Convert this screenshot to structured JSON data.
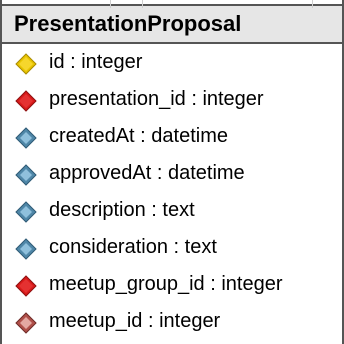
{
  "entity": {
    "title": "PresentationProposal",
    "attributes": [
      {
        "label": "id : integer",
        "icon": "primary-key-icon",
        "color": "#e8c400"
      },
      {
        "label": "presentation_id : integer",
        "icon": "foreign-key-icon",
        "color": "#d81a1a"
      },
      {
        "label": "createdAt : datetime",
        "icon": "column-icon",
        "color": "#4f87a8"
      },
      {
        "label": "approvedAt : datetime",
        "icon": "column-icon",
        "color": "#4f87a8"
      },
      {
        "label": "description : text",
        "icon": "column-icon",
        "color": "#4f87a8"
      },
      {
        "label": "consideration : text",
        "icon": "column-icon",
        "color": "#4f87a8"
      },
      {
        "label": "meetup_group_id : integer",
        "icon": "foreign-key-icon",
        "color": "#d81a1a"
      },
      {
        "label": "meetup_id : integer",
        "icon": "nullable-foreign-key-icon",
        "color": "#b0504a"
      }
    ]
  }
}
